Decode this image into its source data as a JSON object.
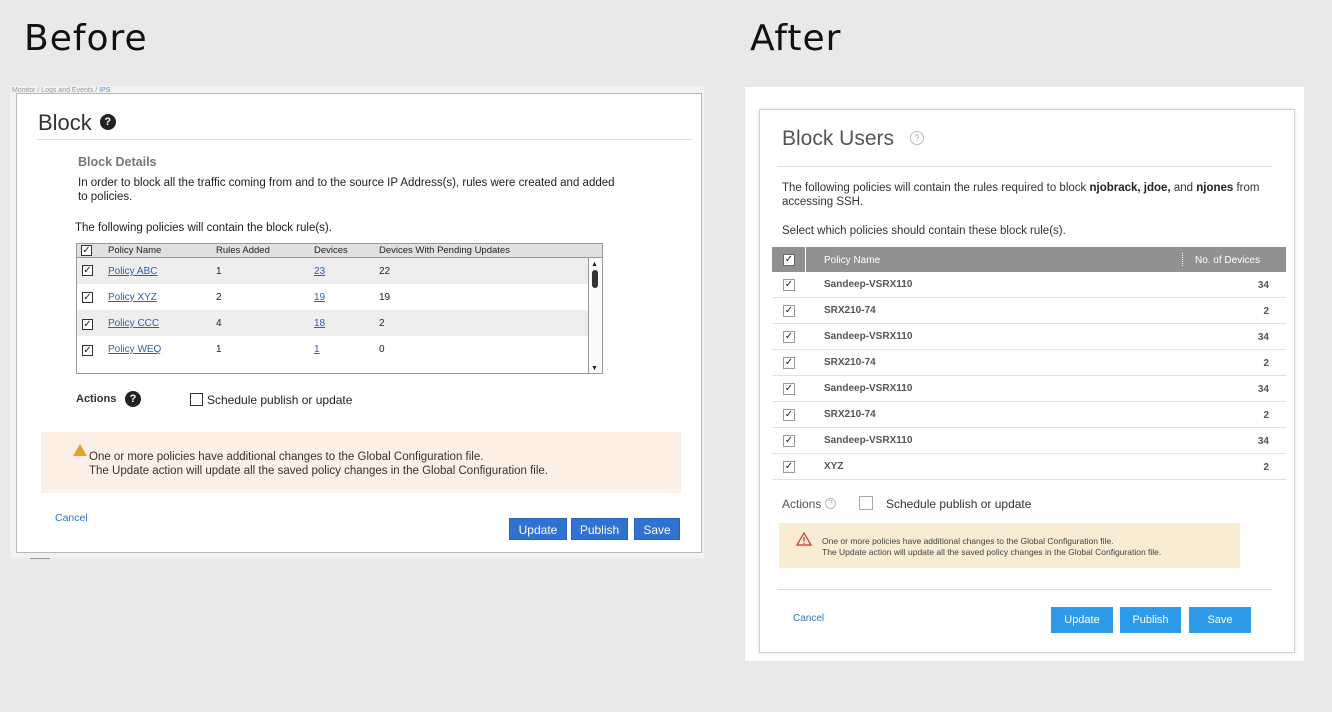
{
  "headings": {
    "before": "Before",
    "after": "After"
  },
  "before": {
    "breadcrumb_prefix": "Monitor / Logs and Events / ",
    "breadcrumb_current": "IPS",
    "title": "Block",
    "details_title": "Block Details",
    "details_text": "In order to block all the traffic coming from and to the source IP Address(s), rules were created and added to policies.",
    "policies_intro": "The following policies will contain the block rule(s).",
    "columns": [
      "Policy Name",
      "Rules Added",
      "Devices",
      "Devices With Pending Updates"
    ],
    "rows": [
      {
        "name": "Policy ABC",
        "rules": "1",
        "devices": "23",
        "pending": "22"
      },
      {
        "name": "Policy XYZ",
        "rules": "2",
        "devices": "19",
        "pending": "19"
      },
      {
        "name": "Policy CCC",
        "rules": "4",
        "devices": "18",
        "pending": "2"
      },
      {
        "name": "Policy WEQ",
        "rules": "1",
        "devices": "1",
        "pending": "0"
      }
    ],
    "actions_label": "Actions",
    "schedule_label": "Schedule publish or update",
    "warning_line1": "One or more policies have additional changes to the Global Configuration file.",
    "warning_line2": "The Update action will update all the saved policy changes in the Global Configuration file.",
    "cancel": "Cancel",
    "update": "Update",
    "publish": "Publish",
    "save": "Save"
  },
  "after": {
    "title": "Block Users",
    "intro_pre": "The following policies will contain the rules required to block ",
    "intro_users": "njobrack, jdoe,",
    "intro_and": " and ",
    "intro_last": "njones",
    "intro_post": " from accessing SSH.",
    "select_text": "Select which policies should contain these block rule(s).",
    "col_name": "Policy Name",
    "col_devices": "No. of Devices",
    "rows": [
      {
        "name": "Sandeep-VSRX110",
        "devices": "34"
      },
      {
        "name": "SRX210-74",
        "devices": "2"
      },
      {
        "name": "Sandeep-VSRX110",
        "devices": "34"
      },
      {
        "name": "SRX210-74",
        "devices": "2"
      },
      {
        "name": "Sandeep-VSRX110",
        "devices": "34"
      },
      {
        "name": "SRX210-74",
        "devices": "2"
      },
      {
        "name": "Sandeep-VSRX110",
        "devices": "34"
      },
      {
        "name": "XYZ",
        "devices": "2"
      }
    ],
    "actions_label": "Actions",
    "schedule_label": "Schedule publish or update",
    "warning_line1": "One or more policies have additional changes to the Global Configuration file.",
    "warning_line2": "The Update action will update all the saved policy changes in the Global Configuration file.",
    "cancel": "Cancel",
    "update": "Update",
    "publish": "Publish",
    "save": "Save"
  },
  "colors": {
    "before_button": "#2f72d1",
    "after_button": "#2e9bea",
    "after_header": "#919191",
    "before_warning_bg": "#fdf0e6",
    "after_warning_bg": "#f8ecd2",
    "warning_icon": "#e8a02c"
  },
  "icons": [
    "help-icon",
    "checkbox-checked-icon",
    "warning-icon",
    "scroll-arrow-icon"
  ]
}
